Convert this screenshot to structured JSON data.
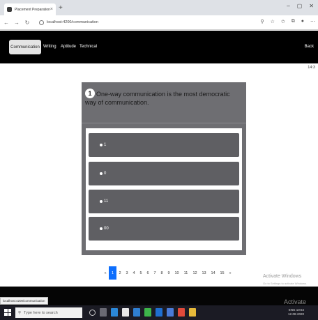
{
  "browser": {
    "tab_title": "Placement Preparation",
    "tab_close": "×",
    "new_tab": "+",
    "url": "localhost:4200/communication",
    "window_controls": [
      "–",
      "▢",
      "✕"
    ]
  },
  "nav": {
    "items": [
      {
        "label": "Communication",
        "active": true
      },
      {
        "label": "Writing"
      },
      {
        "label": "Aptitude"
      },
      {
        "label": "Technical"
      }
    ],
    "back": "Back"
  },
  "timer": "14:3",
  "question": {
    "number": "1",
    "text": "One-way communication is the most democratic way of communication.",
    "options": [
      "1",
      "0",
      "11",
      "00"
    ]
  },
  "pagination": {
    "prev": "«",
    "pages": [
      "1",
      "2",
      "3",
      "4",
      "5",
      "6",
      "7",
      "8",
      "9",
      "10",
      "11",
      "12",
      "13",
      "14",
      "15"
    ],
    "active": "1",
    "next": "»"
  },
  "watermark": {
    "line1": "Activate Windows",
    "line2": "Go to Settings to activate Windows.",
    "line3": "Activate Windo"
  },
  "status_url": "localhost:4200/communication",
  "taskbar": {
    "search_placeholder": "Type here to search",
    "tray_time": "10:54",
    "tray_date": "12-08-2020",
    "tray_lang": "ENG"
  },
  "colors": {
    "card_bg": "#6e6e72",
    "option_bg": "#5f5f63",
    "active_page": "#0d6efd",
    "navbar": "#000000"
  }
}
